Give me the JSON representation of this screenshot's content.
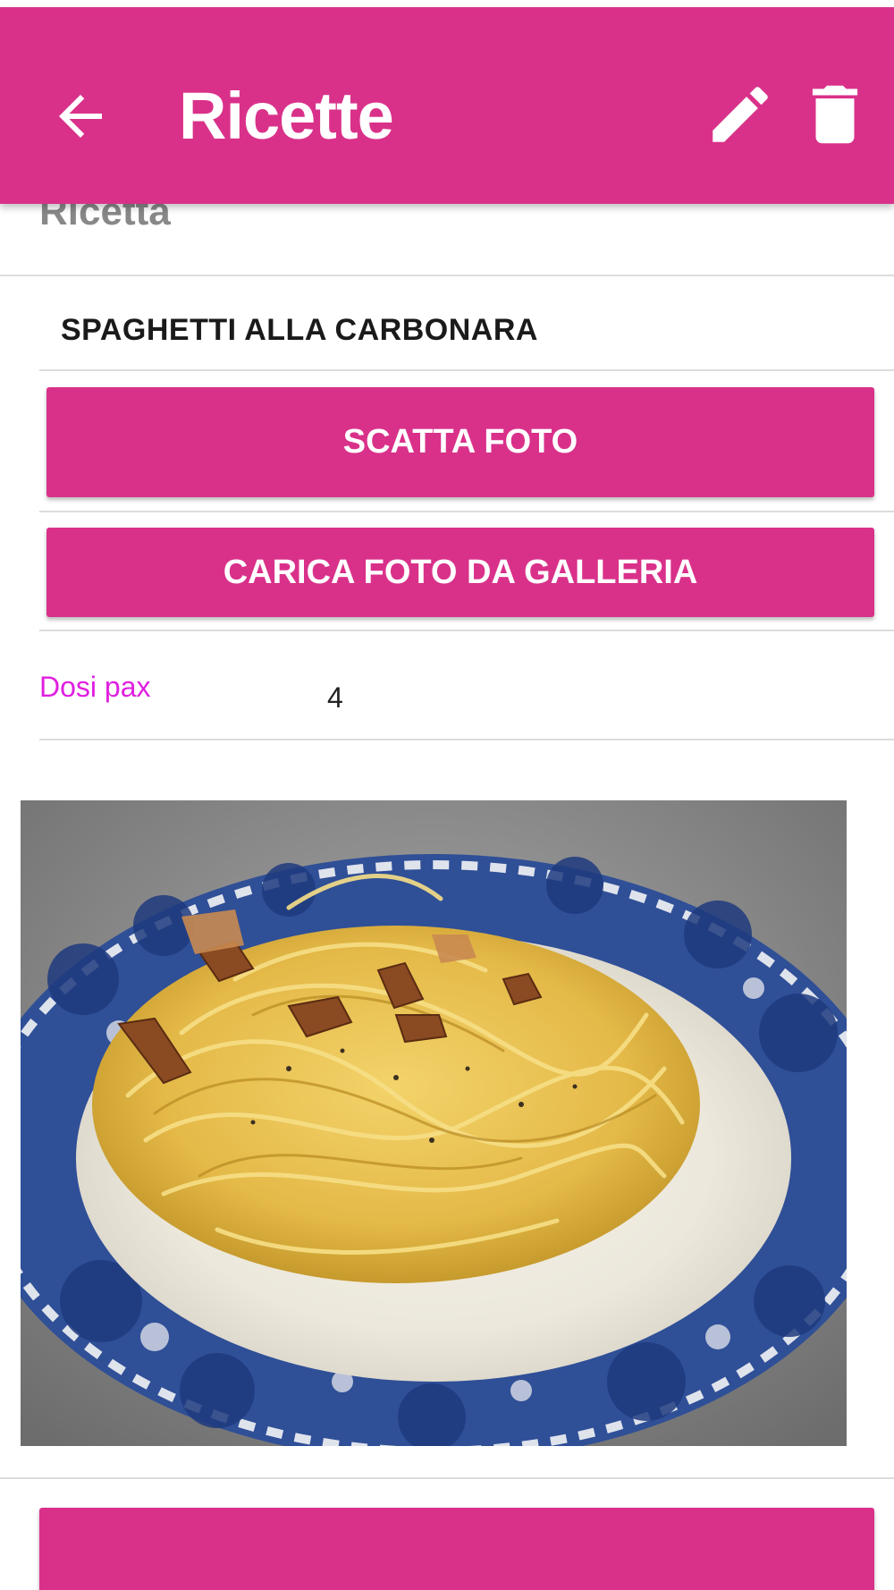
{
  "appbar": {
    "title": "Ricette",
    "back_icon": "arrow-back-icon",
    "edit_icon": "pencil-icon",
    "delete_icon": "trash-icon",
    "color": "#d9318a"
  },
  "form": {
    "section_label": "Ricetta",
    "recipe_name": "SPAGHETTI ALLA CARBONARA",
    "take_photo_label": "SCATTA FOTO",
    "gallery_label": "CARICA FOTO DA GALLERIA",
    "portions_label": "Dosi pax",
    "portions_value": "4"
  },
  "colors": {
    "accent": "#d9318a",
    "field_label": "#e01fe0",
    "divider": "#dcdcdc"
  }
}
